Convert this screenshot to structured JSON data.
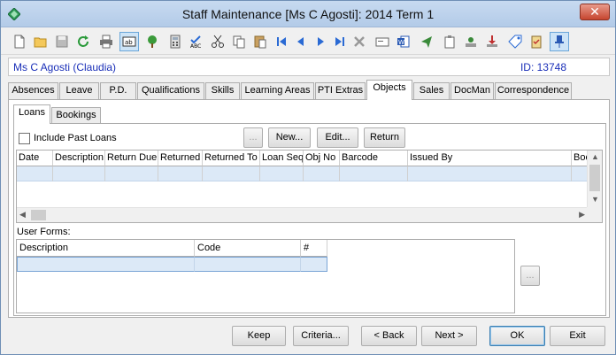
{
  "window": {
    "title": "Staff Maintenance  [Ms C Agosti]:  2014 Term 1",
    "close_glyph": "✕"
  },
  "toolbar": {
    "icons": [
      "new-icon",
      "open-icon",
      "save-icon",
      "refresh-icon",
      "print-icon",
      "text-field-icon",
      "tree-icon",
      "calculator-icon",
      "spellcheck-icon",
      "cut-icon",
      "copy-icon",
      "paste-icon",
      "first-record-icon",
      "previous-record-icon",
      "next-record-icon",
      "last-record-icon",
      "delete-icon",
      "card-icon",
      "word-icon",
      "send-icon",
      "clipboard-icon",
      "stamp-icon",
      "download-icon",
      "tag-icon",
      "checklist-icon",
      "pin-icon"
    ]
  },
  "student": {
    "name": "Ms C Agosti (Claudia)",
    "id_label": "ID: 13748"
  },
  "tabs": [
    {
      "label": "Absences"
    },
    {
      "label": "Leave"
    },
    {
      "label": "P.D."
    },
    {
      "label": "Qualifications"
    },
    {
      "label": "Skills"
    },
    {
      "label": "Learning Areas"
    },
    {
      "label": "PTI Extras"
    },
    {
      "label": "Objects"
    },
    {
      "label": "Sales"
    },
    {
      "label": "DocMan"
    },
    {
      "label": "Correspondence"
    }
  ],
  "active_tab": "Objects",
  "subtabs": [
    {
      "label": "Loans"
    },
    {
      "label": "Bookings"
    }
  ],
  "loans": {
    "include_past_label": "Include Past Loans",
    "include_past_checked": false,
    "ellipsis_button": "...",
    "new_button": "New...",
    "edit_button": "Edit...",
    "return_button": "Return",
    "columns": [
      "Date",
      "Description",
      "Return Due",
      "Returned",
      "Returned To",
      "Loan Seq",
      "Obj  No",
      "Barcode",
      "Issued By",
      "Boo"
    ]
  },
  "user_forms": {
    "label": "User Forms:",
    "columns": [
      "Description",
      "Code",
      "#"
    ],
    "side_button": "..."
  },
  "bottom_buttons": {
    "keep": "Keep",
    "criteria": "Criteria...",
    "back": "< Back",
    "next": "Next >",
    "ok": "OK",
    "exit": "Exit"
  },
  "colors": {
    "accent": "#1a2fb8",
    "selection": "#dce9f7",
    "title_bar": "#c7daf0"
  }
}
